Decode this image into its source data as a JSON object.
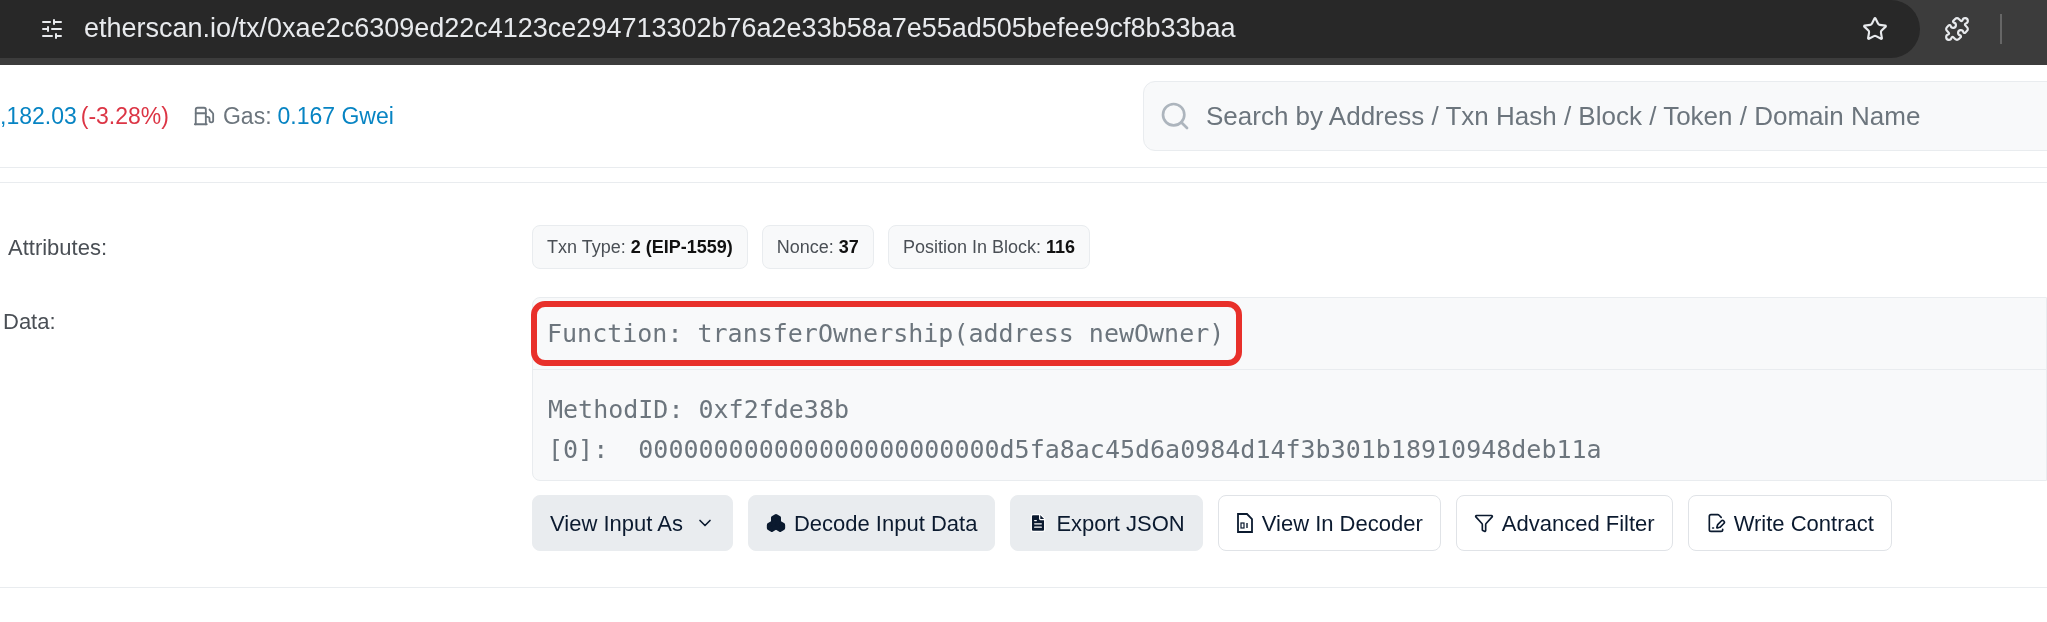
{
  "browser": {
    "url": "etherscan.io/tx/0xae2c6309ed22c4123ce294713302b76a2e33b58a7e55ad505befee9cf8b33baa"
  },
  "header": {
    "price": ",182.03",
    "change": "(-3.28%)",
    "gas_label": "Gas:",
    "gas_value": "0.167 Gwei",
    "search": {
      "placeholder": "Search by Address / Txn Hash / Block / Token / Domain Name"
    }
  },
  "attributes": {
    "label": "Attributes:",
    "badges": [
      {
        "label": "Txn Type:",
        "value": "2 (EIP-1559)"
      },
      {
        "label": "Nonce:",
        "value": "37"
      },
      {
        "label": "Position In Block:",
        "value": "116"
      }
    ]
  },
  "data": {
    "label": "Data:",
    "function": "Function: transferOwnership(address newOwner)",
    "highlighted": true,
    "lines": [
      "MethodID: 0xf2fde38b",
      "[0]:  000000000000000000000000d5fa8ac45d6a0984d14f3b301b18910948deb11a"
    ]
  },
  "buttons": [
    {
      "label": "View Input As",
      "kind": "dropdown"
    },
    {
      "label": "Decode Input Data",
      "kind": "filled"
    },
    {
      "label": "Export JSON",
      "kind": "filled"
    },
    {
      "label": "View In Decoder",
      "kind": "outlined"
    },
    {
      "label": "Advanced Filter",
      "kind": "outlined"
    },
    {
      "label": "Write Contract",
      "kind": "outlined"
    }
  ]
}
